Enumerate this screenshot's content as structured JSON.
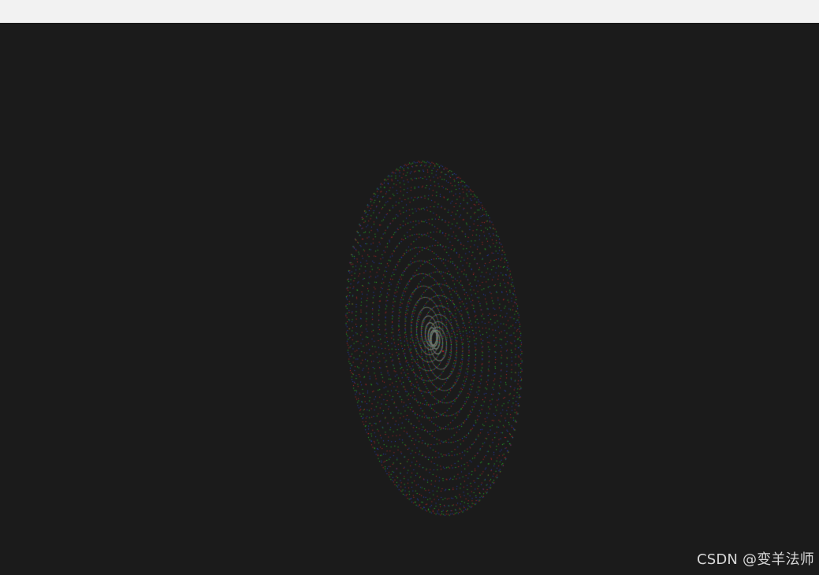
{
  "window": {
    "background_color": "#1b1b1b",
    "titlebar_color": "#f2f2f2"
  },
  "viewer": {
    "content": "point-cloud",
    "point_colors": [
      "#ff3030",
      "#30ff30",
      "#3050ff"
    ]
  },
  "watermark": {
    "text": "CSDN @变羊法师"
  }
}
